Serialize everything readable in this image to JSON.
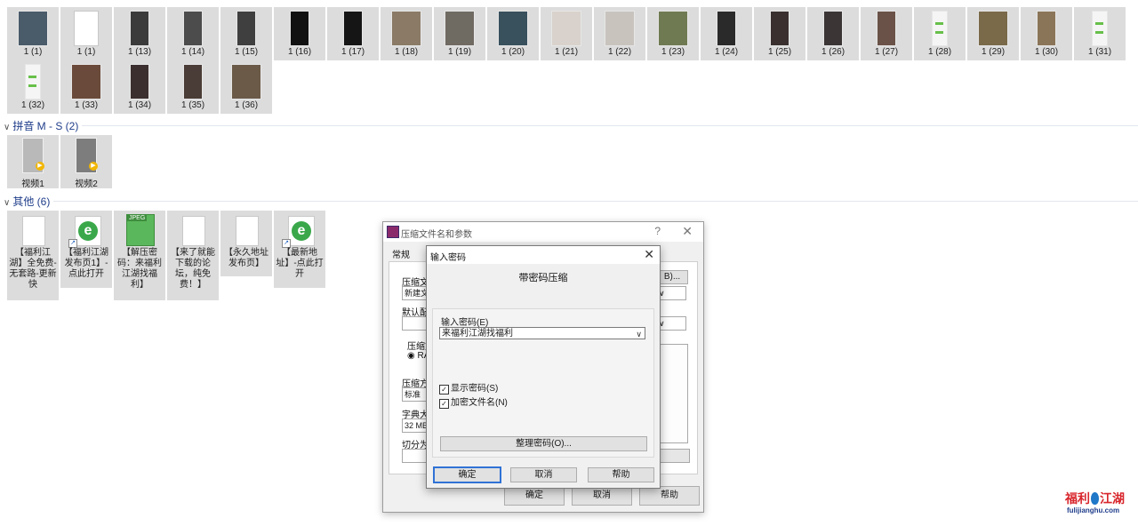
{
  "group1": {
    "row1": [
      "1 (1)",
      "1 (1)",
      "1 (13)",
      "1 (14)",
      "1 (15)",
      "1 (16)",
      "1 (17)",
      "1 (18)",
      "1 (19)",
      "1 (20)",
      "1 (21)",
      "1 (22)",
      "1 (23)",
      "1 (24)",
      "1 (25)",
      "1 (26)",
      "1 (27)",
      "1 (28)",
      "1 (29)",
      "1 (30)",
      "1 (31)"
    ],
    "row2": [
      "1 (32)",
      "1 (33)",
      "1 (34)",
      "1 (35)",
      "1 (36)"
    ]
  },
  "group2": {
    "title": "拼音 M - S (2)",
    "items": [
      "视频1",
      "视频2"
    ]
  },
  "group3": {
    "title": "其他 (6)",
    "items": [
      "【福利江湖】全免费-无套路-更新快",
      "【福利江湖发布页1】-点此打开",
      "【解压密码：来福利江湖找福利】",
      "【来了就能下载的论坛，纯免费！】",
      "【永久地址发布页】",
      "【最新地址】-点此打开"
    ]
  },
  "back_dialog": {
    "title": "压缩文件名和参数",
    "help": "?",
    "tab": "常规",
    "label_archive": "压缩文",
    "archive_value": "新建文",
    "label_default": "默认配",
    "label_format": "压缩文",
    "format_value": "RA",
    "label_method": "压缩方",
    "method_value": "标准",
    "label_dict": "字典大",
    "dict_value": "32 MB",
    "label_split": "切分为",
    "browse_btn": "B)...",
    "ok": "确定",
    "cancel": "取消",
    "help_btn": "帮助"
  },
  "front_dialog": {
    "title": "输入密码",
    "heading": "带密码压缩",
    "pw_label": "输入密码(E)",
    "pw_value": "来福利江湖找福利",
    "show_pw": "显示密码(S)",
    "encrypt_names": "加密文件名(N)",
    "organize": "整理密码(O)...",
    "ok": "确定",
    "cancel": "取消",
    "help": "帮助"
  },
  "watermark": {
    "main_left": "福利",
    "main_right": "江湖",
    "url": "fulijianghu.com"
  }
}
